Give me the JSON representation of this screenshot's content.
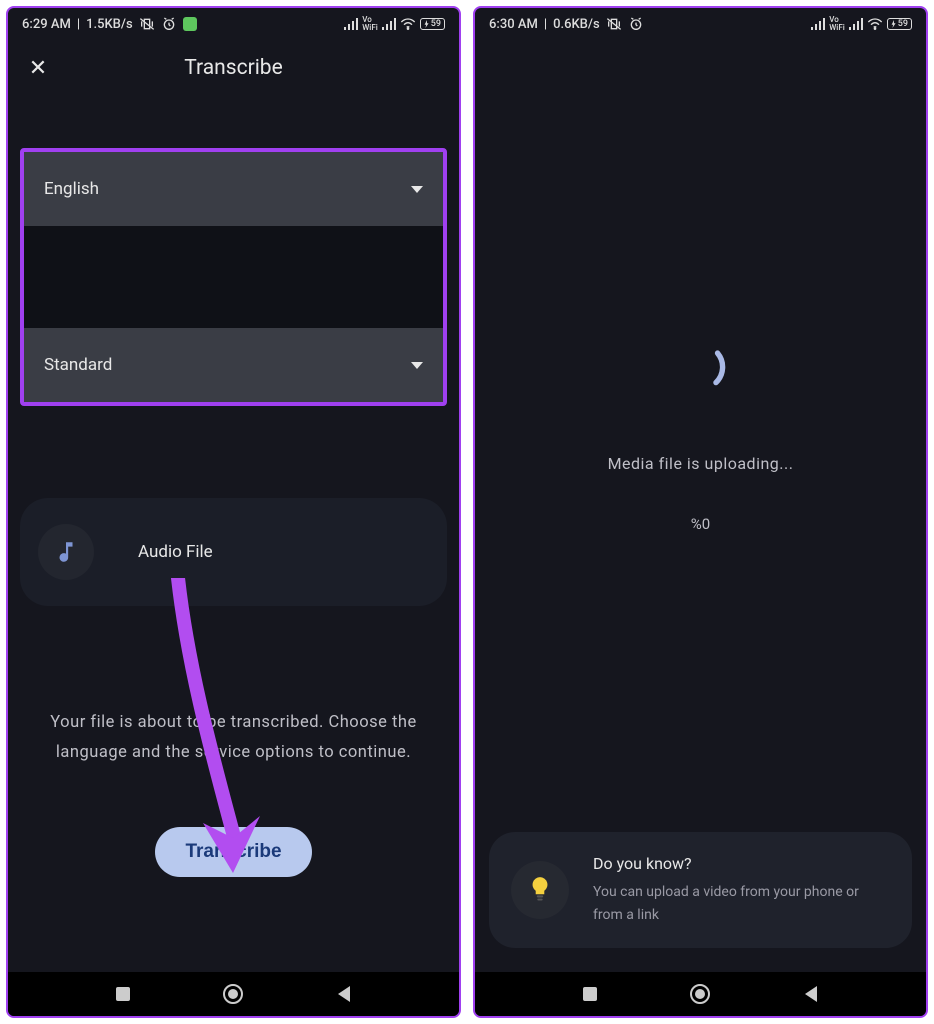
{
  "left": {
    "status": {
      "time": "6:29 AM",
      "net": "1.5KB/s"
    },
    "appbar": {
      "title": "Transcribe"
    },
    "selects": {
      "language": "English",
      "mode": "Standard"
    },
    "file": {
      "label": "Audio File"
    },
    "helper": "Your file is about to be transcribed. Choose the language and the service options to continue.",
    "primary": "Transcribe"
  },
  "right": {
    "status": {
      "time": "6:30 AM",
      "net": "0.6KB/s"
    },
    "upload": {
      "text": "Media file is uploading...",
      "percent": "%0"
    },
    "tip": {
      "title": "Do you know?",
      "body": "You can upload a video from your phone or from a link"
    }
  },
  "status_extra": {
    "vo": "Vo",
    "wifi": "WiFi",
    "battery": "59"
  }
}
